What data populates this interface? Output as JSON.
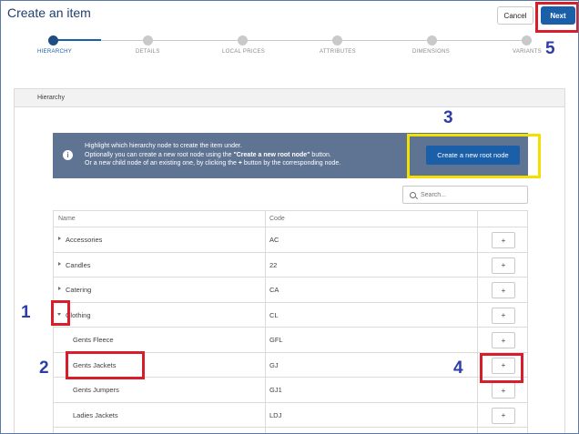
{
  "header": {
    "title": "Create an item",
    "cancel_label": "Cancel",
    "next_label": "Next"
  },
  "stepper": {
    "steps": [
      {
        "label": "HIERARCHY",
        "active": true
      },
      {
        "label": "DETAILS",
        "active": false
      },
      {
        "label": "LOCAL PRICES",
        "active": false
      },
      {
        "label": "ATTRIBUTES",
        "active": false
      },
      {
        "label": "DIMENSIONS",
        "active": false
      },
      {
        "label": "VARIANTS",
        "active": false
      }
    ]
  },
  "panel": {
    "heading": "Hierarchy"
  },
  "info": {
    "icon": "info-icon",
    "line1": "Highlight which hierarchy node to create the item under.",
    "line2_prefix": "Optionally you can create a new root node using the ",
    "line2_bold": "\"Create a new root node\"",
    "line2_suffix": " button.",
    "line3_prefix": "Or a new child node of an existing one, by clicking the ",
    "line3_bold": "+",
    "line3_suffix": " button by the corresponding node.",
    "create_root_label": "Create a new root node"
  },
  "search": {
    "placeholder": "Search..."
  },
  "table": {
    "columns": {
      "name": "Name",
      "code": "Code"
    },
    "add_label": "+",
    "rows": [
      {
        "name": "Accessories",
        "code": "AC",
        "level": 0,
        "caret": "right"
      },
      {
        "name": "Candles",
        "code": "22",
        "level": 0,
        "caret": "right"
      },
      {
        "name": "Catering",
        "code": "CA",
        "level": 0,
        "caret": "right"
      },
      {
        "name": "Clothing",
        "code": "CL",
        "level": 0,
        "caret": "down"
      },
      {
        "name": "Gents Fleece",
        "code": "GFL",
        "level": 1,
        "caret": ""
      },
      {
        "name": "Gents Jackets",
        "code": "GJ",
        "level": 1,
        "caret": ""
      },
      {
        "name": "Gents Jumpers",
        "code": "GJ1",
        "level": 1,
        "caret": ""
      },
      {
        "name": "Ladies Jackets",
        "code": "LDJ",
        "level": 1,
        "caret": ""
      }
    ]
  },
  "annotations": {
    "n1": "1",
    "n2": "2",
    "n3": "3",
    "n4": "4",
    "n5": "5"
  },
  "colors": {
    "accent": "#1b5fa8",
    "info_bg": "#5f7493",
    "highlight_red": "#d81e2a",
    "highlight_yellow": "#f4e000",
    "annotation_number": "#2d3ea8"
  }
}
